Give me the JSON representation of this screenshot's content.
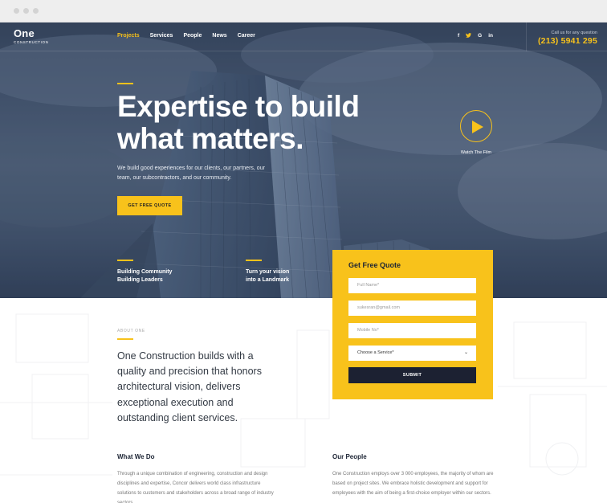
{
  "brand": {
    "name": "One",
    "sub": "CONSTRUCTION"
  },
  "nav": {
    "items": [
      "Projects",
      "Services",
      "People",
      "News",
      "Career"
    ],
    "active": "Projects"
  },
  "social": [
    "f",
    "t",
    "G",
    "in"
  ],
  "contact": {
    "label": "Call us for any question",
    "phone": "(213) 5941 295"
  },
  "hero": {
    "headline_line1": "Expertise to build",
    "headline_line2": "what matters.",
    "subtext": "We build good experiences for our clients, our partners, our team, our subcontractors, and our community.",
    "cta_label": "GET FREE QUOTE",
    "video_label": "Watch The Film",
    "feature1_line1": "Building Community",
    "feature1_line2": "Building Leaders",
    "feature2_line1": "Turn your vision",
    "feature2_line2": "into a Landmark"
  },
  "quote_form": {
    "title": "Get Free Quote",
    "name_placeholder": "Full Name*",
    "email_placeholder": "sukesran@gmail.com",
    "mobile_placeholder": "Mobile No*",
    "service_select": "Choose a Service*",
    "submit_label": "SUBMIT"
  },
  "about": {
    "label": "ABOUT ONE",
    "text": "One Construction builds with a quality and precision that honors architectural vision, delivers exceptional execution and outstanding client services."
  },
  "what_we_do": {
    "title": "What We Do",
    "text": "Through a unique combination of engineering, construction and design disciplines and expertise, Concor delivers world class infrastructure solutions to customers and stakeholders across a broad range of industry sectors."
  },
  "our_people": {
    "title": "Our People",
    "text": "One Construction employs over 3 000 employees, the majority of whom are based on project sites. We embrace holistic development and support for employees with the aim of being a first-choice employer within our sectors."
  },
  "colors": {
    "accent": "#f8c21b",
    "dark": "#1c2132"
  }
}
